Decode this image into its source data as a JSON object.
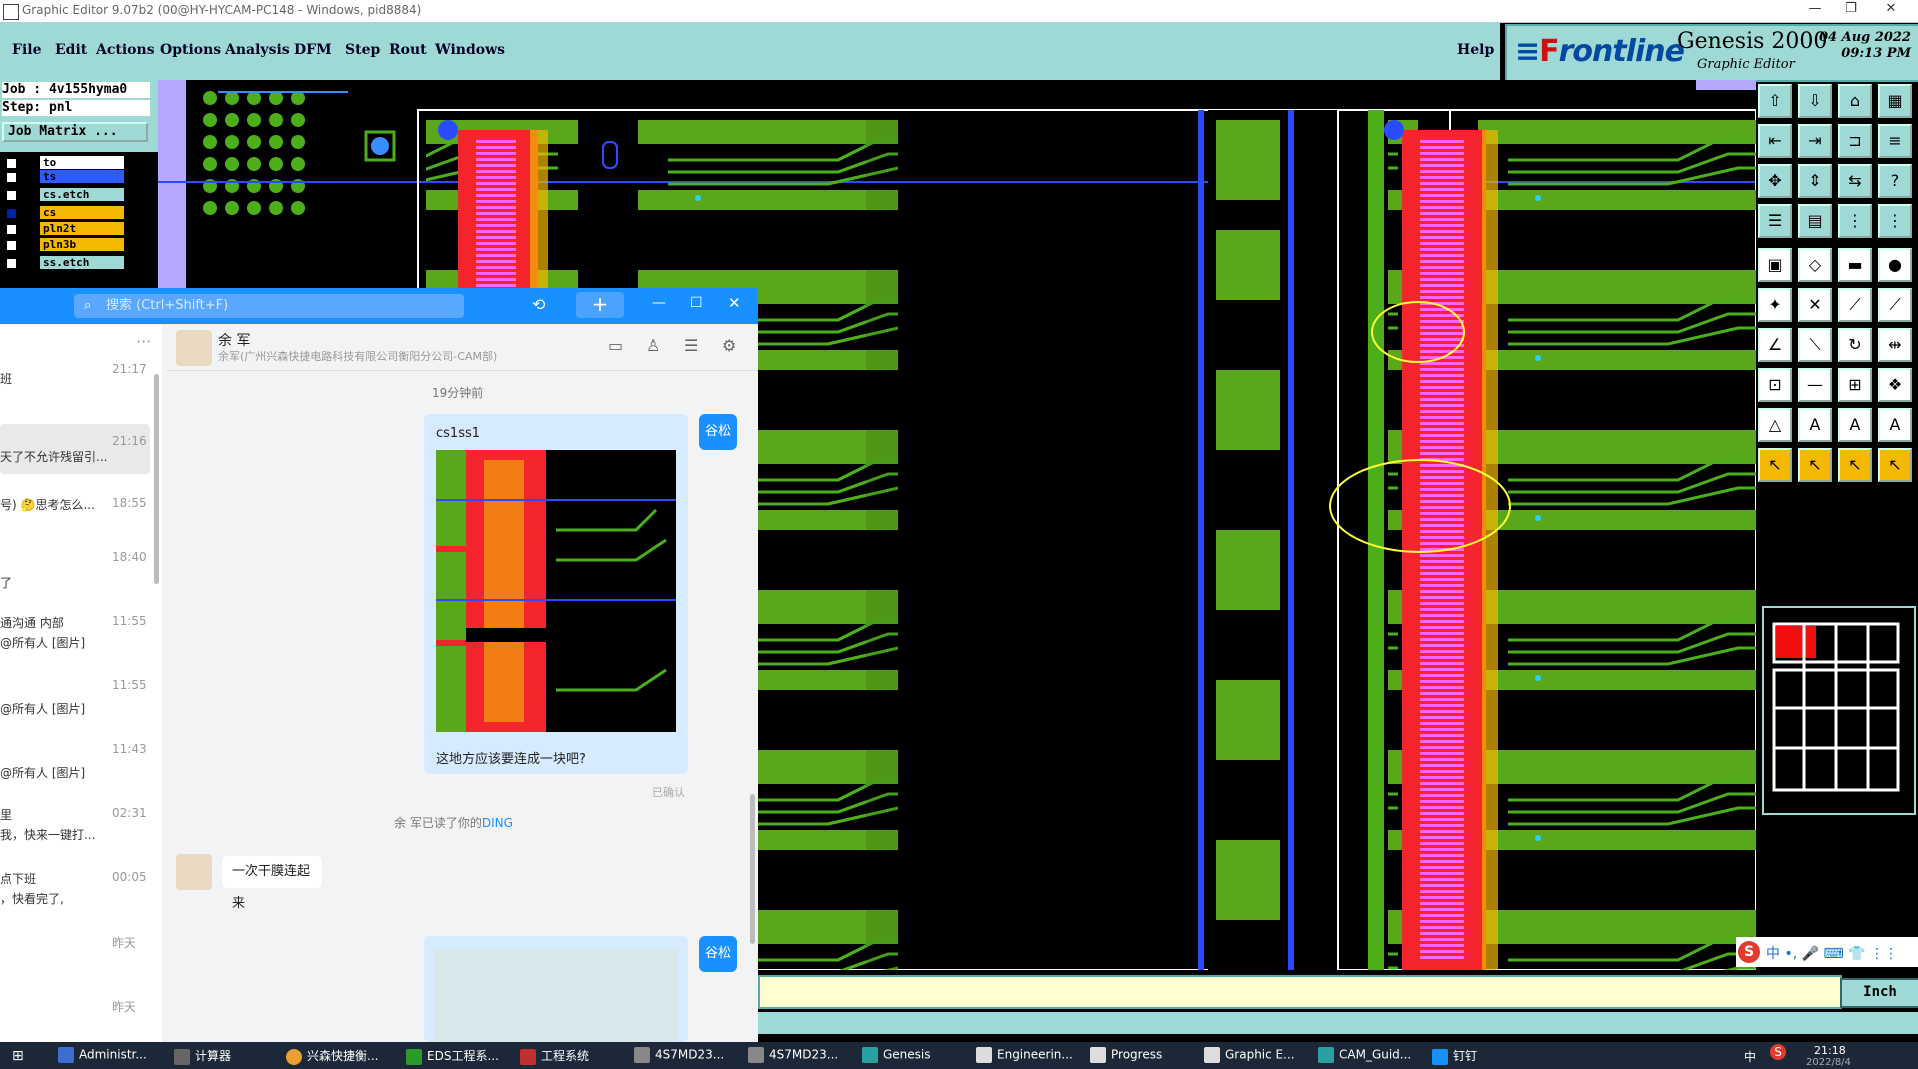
{
  "window": {
    "title": "Graphic Editor 9.07b2 (00@HY-HYCAM-PC148 - Windows, pid8884)",
    "controls": [
      "—",
      "❐",
      "✕"
    ]
  },
  "menu": {
    "items": [
      "File",
      "Edit",
      "Actions",
      "Options",
      "Analysis",
      "DFM",
      "Step",
      "Rout",
      "Windows"
    ],
    "help": "Help"
  },
  "brand": {
    "logo_prefix": "F",
    "logo_rest": "rontline",
    "product": "Genesis 2000",
    "subtitle": "Graphic Editor",
    "date": "04 Aug 2022",
    "time": "09:13 PM"
  },
  "left_panel": {
    "job": "Job : 4v155hyma0",
    "step": "Step: pnl",
    "job_matrix": "Job Matrix ...",
    "layers": [
      {
        "name": "to",
        "color": "#ffffff"
      },
      {
        "name": "ts",
        "color": "#2d5cff"
      },
      {
        "name": "cs.etch",
        "color": "#9fd9d6"
      },
      {
        "name": "cs",
        "color": "#f5b800"
      },
      {
        "name": "pln2t",
        "color": "#f5b800"
      },
      {
        "name": "pln3b",
        "color": "#f5b800"
      },
      {
        "name": "ss.etch",
        "color": "#9fd9d6"
      }
    ]
  },
  "status": {
    "units_button": "Inch"
  },
  "ime": {
    "text": "中 •, 🎤 ⌨ 👕 ⋮⋮"
  },
  "chat": {
    "search_placeholder": "搜索 (Ctrl+Shift+F)",
    "add_button": "+",
    "win_controls": [
      "—",
      "☐",
      "✕"
    ],
    "contact_name": "余 军",
    "contact_org": "余军(广州兴森快捷电路科技有限公司衡阳分公司-CAM部)",
    "time_divider": "19分钟前",
    "my_badge": "谷松",
    "msg_caption": "cs1ss1",
    "msg_text": "这地方应该要连成一块吧?",
    "read_status": "已确认",
    "ding_notice_prefix": "余 军已读了你的",
    "ding_notice_link": "DING",
    "reply": "一次干膜连起来",
    "list": [
      {
        "text": "班",
        "time": "21:17"
      },
      {
        "text": "天了不允许残留引...",
        "time": "21:16"
      },
      {
        "text": "号) 🤔思考怎么...",
        "time": "18:55"
      },
      {
        "text": "了",
        "time": "18:40"
      },
      {
        "text": "通沟通  内部",
        "time": "11:55"
      },
      {
        "text": "@所有人 [图片]",
        "time": ""
      },
      {
        "text": "@所有人 [图片]",
        "time": "11:55"
      },
      {
        "text": "@所有人 [图片]",
        "time": "11:43"
      },
      {
        "text": "里",
        "time": "02:31"
      },
      {
        "text": "我，快来一键打...",
        "time": ""
      },
      {
        "text": "点下班",
        "time": "00:05"
      },
      {
        "text": "，快看完了,",
        "time": ""
      },
      {
        "text": "",
        "time": "昨天"
      },
      {
        "text": "",
        "time": "昨天"
      }
    ]
  },
  "taskbar": {
    "items": [
      "Administr...",
      "计算器",
      "兴森快捷衡...",
      "EDS工程系...",
      "工程系统",
      "4S7MD23...",
      "4S7MD23...",
      "Genesis",
      "Engineerin...",
      "Progress",
      "Graphic E...",
      "CAM_Guid...",
      "钉钉"
    ],
    "clock_time": "21:18",
    "clock_date": "2022/8/4",
    "tray_lang": "中",
    "tray_badge": "S"
  }
}
